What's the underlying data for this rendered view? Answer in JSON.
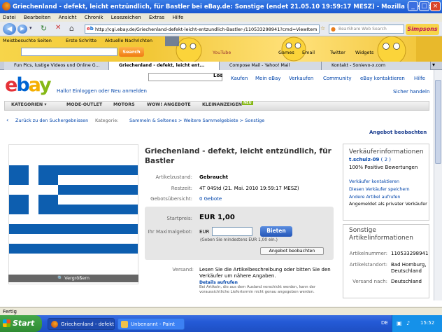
{
  "window": {
    "title": "Griechenland - defekt, leicht entzündlich, für Bastler bei eBay.de: Sonstige (endet 21.05.10 19:59:17 MESZ) - Mozilla Firefox"
  },
  "menu": [
    "Datei",
    "Bearbeiten",
    "Ansicht",
    "Chronik",
    "Lesezeichen",
    "Extras",
    "Hilfe"
  ],
  "nav": {
    "url": "http://cgi.ebay.de/Griechenland-defekt-leicht-entzundlich-Bastler-/110533298941?cmd=ViewItem",
    "search_placeholder": "BearShare Web Search"
  },
  "bookmarks": [
    "Meistbesuchte Seiten",
    "Erste Schritte",
    "Aktuelle Nachrichten"
  ],
  "toolbar": {
    "search_label": "Search",
    "items": [
      "Games",
      "Email",
      "Twitter",
      "Widgets",
      "YouTube"
    ]
  },
  "tabs": [
    "Fun Pics, lustige Videos und Online G...",
    "Griechenland - defekt, leicht ent...",
    "Compose Mail - Yahoo! Mail",
    "Kontakt - Sonievo-x.com"
  ],
  "ebay": {
    "header_links": [
      "Kaufen",
      "Mein eBay",
      "Verkaufen",
      "Community",
      "eBay kontaktieren",
      "Hilfe"
    ],
    "search_button": "Los",
    "greeting": "Hallo! Einloggen oder Neu anmelden",
    "safe_shopping": "Sicher handeln",
    "categories": [
      "KATEGORIEN",
      "MODE-OUTLET",
      "MOTORS",
      "WOW! ANGEBOTE",
      "KLEINANZEIGEN"
    ],
    "new_badge": "NEU",
    "back_link": "Zurück zu den Suchergebnissen",
    "breadcrumb_label": "Kategorie:",
    "breadcrumb": "Sammeln & Seltenes > Weitere Sammelgebiete > Sonstige",
    "watch_link": "Angebot beobachten",
    "item_title": "Griechenland - defekt, leicht entzündlich, für Bastler",
    "condition_label": "Artikelzustand:",
    "condition": "Gebraucht",
    "time_label": "Restzeit:",
    "time": "4T 04Std (21. Mai. 2010 19:59:17 MESZ)",
    "bids_label": "Gebotsübersicht:",
    "bids": "0 Gebote",
    "start_price_label": "Startpreis:",
    "start_price": "EUR 1,00",
    "max_bid_label": "Ihr Maximalgebot:",
    "currency": "EUR",
    "bid_button": "Bieten",
    "min_bid_hint": "(Geben Sie mindestens EUR 1,00 ein.)",
    "watch_button": "Angebot beobachten",
    "shipping_label": "Versand:",
    "shipping_text": "Lesen Sie die Artikelbeschreibung oder bitten Sie den Verkäufer um nähere Angaben.",
    "details_link": "Details aufrufen",
    "shipping_note": "Bei Artikeln, die aus dem Ausland verschickt werden, kann der voraussichtliche Liefertermin nicht genau angegeben werden.",
    "enlarge_label": "Vergrößern",
    "seller_head": "Verkäuferinformationen",
    "seller_name": "t.schulz-09",
    "seller_score": "( 2 )",
    "seller_rating": "100% Positive Bewertungen",
    "seller_links": [
      "Verkäufer kontaktieren",
      "Diesen Verkäufer speichern",
      "Andere Artikel aufrufen"
    ],
    "seller_type": "Angemeldet als privater Verkäufer",
    "other_head": "Sonstige Artikelinformationen",
    "item_no_label": "Artikelnummer:",
    "item_no": "110533298941",
    "location_label": "Artikelstandort:",
    "location": "Bad Homburg, Deutschland",
    "ships_label": "Versand nach:",
    "ships": "Deutschland"
  },
  "status": "Fertig",
  "taskbar": {
    "start": "Start",
    "items": [
      "Griechenland - defekt...",
      "Unbenannt - Paint"
    ],
    "lang": "DE",
    "clock": "15:52"
  },
  "colors": {
    "titlebar": "#245ad6",
    "ebay_blue": "#0064d2",
    "flag_blue": "#0d5eaf",
    "bid_button": "#2456b8"
  }
}
